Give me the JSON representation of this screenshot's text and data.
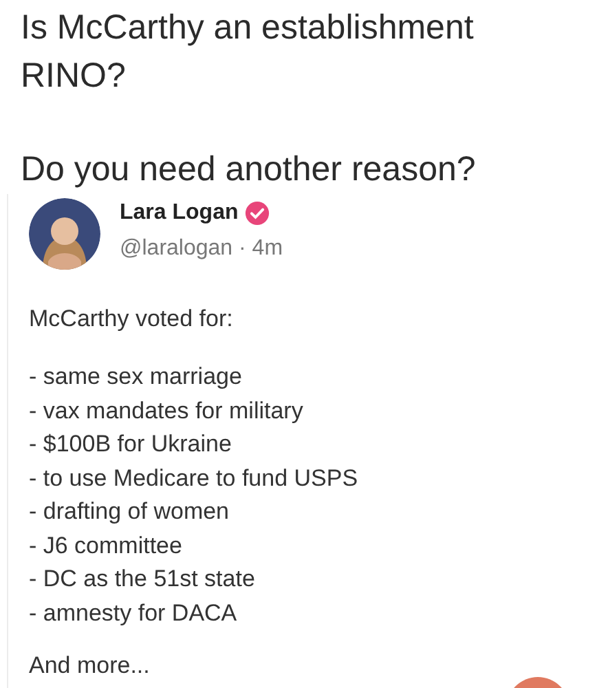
{
  "post": {
    "paragraphs": [
      "Is McCarthy an establishment RINO?",
      "Do you need another reason?"
    ]
  },
  "tweet": {
    "author": "Lara Logan",
    "verified": true,
    "byline": "@laralogan · 4m",
    "intro": "McCarthy voted for:",
    "items": [
      "- same sex marriage",
      "- vax mandates for military",
      "- $100B for Ukraine",
      "- to use Medicare to fund USPS",
      "- drafting of women",
      "- J6 committee",
      "- DC as the 51st state",
      "- amnesty for DACA"
    ],
    "outro": "And more..."
  }
}
